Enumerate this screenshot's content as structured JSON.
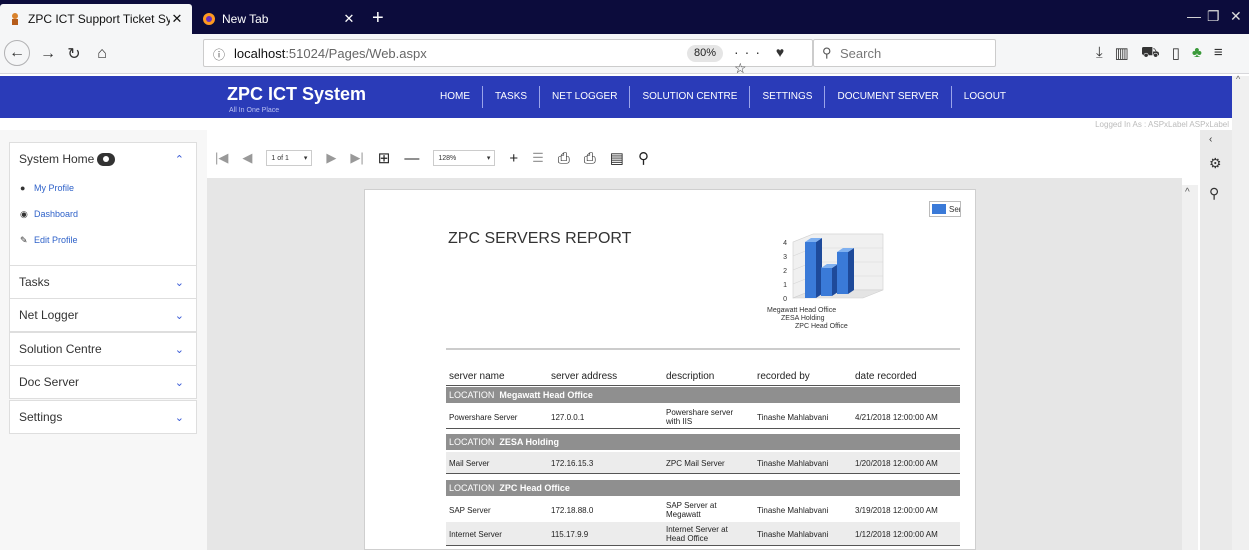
{
  "browser": {
    "tabs": [
      {
        "title": "ZPC ICT Support Ticket System",
        "active": true
      },
      {
        "title": "New Tab",
        "active": false
      }
    ],
    "url_host": "localhost",
    "url_rest": ":51024/Pages/Web.aspx",
    "zoom": "80%",
    "search_placeholder": "Search",
    "window_controls": [
      "—",
      "❐",
      "✕"
    ]
  },
  "app": {
    "brand": "ZPC ICT System",
    "tagline": "All In One Place",
    "menu": [
      "HOME",
      "TASKS",
      "NET LOGGER",
      "SOLUTION CENTRE",
      "SETTINGS",
      "DOCUMENT SERVER",
      "LOGOUT"
    ],
    "logged_in": "Logged In As : ASPxLabel ASPxLabel",
    "accent": "#2a3bb8"
  },
  "sidebar": {
    "system_home": "System Home",
    "sub_items": [
      "My Profile",
      "Dashboard",
      "Edit Profile"
    ],
    "sections": [
      "Tasks",
      "Net Logger",
      "Solution Centre",
      "Doc Server",
      "Settings"
    ]
  },
  "viewer": {
    "page_select": "1 of 1",
    "zoom_select": "128%"
  },
  "report": {
    "title": "ZPC SERVERS REPORT",
    "columns": [
      "server name",
      "server address",
      "description",
      "recorded by",
      "date recorded"
    ],
    "groups": [
      {
        "label": "LOCATION",
        "name": "Megawatt Head Office",
        "rows": [
          [
            "Powershare Server",
            "127.0.0.1",
            "Powershare server with IIS",
            "Tinashe Mahlabvani",
            "4/21/2018 12:00:00 AM"
          ]
        ]
      },
      {
        "label": "LOCATION",
        "name": "ZESA Holding",
        "rows": [
          [
            "Mail Server",
            "172.16.15.3",
            "ZPC Mail Server",
            "Tinashe Mahlabvani",
            "1/20/2018 12:00:00 AM"
          ]
        ]
      },
      {
        "label": "LOCATION",
        "name": "ZPC Head Office",
        "rows": [
          [
            "SAP Server",
            "172.18.88.0",
            "SAP Server at Megawatt",
            "Tinashe Mahlabvani",
            "3/19/2018 12:00:00 AM"
          ],
          [
            "Internet Server",
            "115.17.9.9",
            "Internet Server at Head Office",
            "Tinashe Mahlabvani",
            "1/12/2018 12:00:00 AM"
          ]
        ]
      }
    ]
  },
  "chart_data": {
    "type": "bar",
    "categories": [
      "Megawatt Head Office",
      "ZESA Holding",
      "ZPC Head Office"
    ],
    "series": [
      {
        "name": "Seri",
        "values": [
          4,
          2,
          3
        ]
      }
    ],
    "yticks": [
      "0",
      "1",
      "2",
      "3",
      "4"
    ],
    "ylim": [
      0,
      4
    ],
    "legend": "top-right",
    "color": "#3a7ad8"
  }
}
